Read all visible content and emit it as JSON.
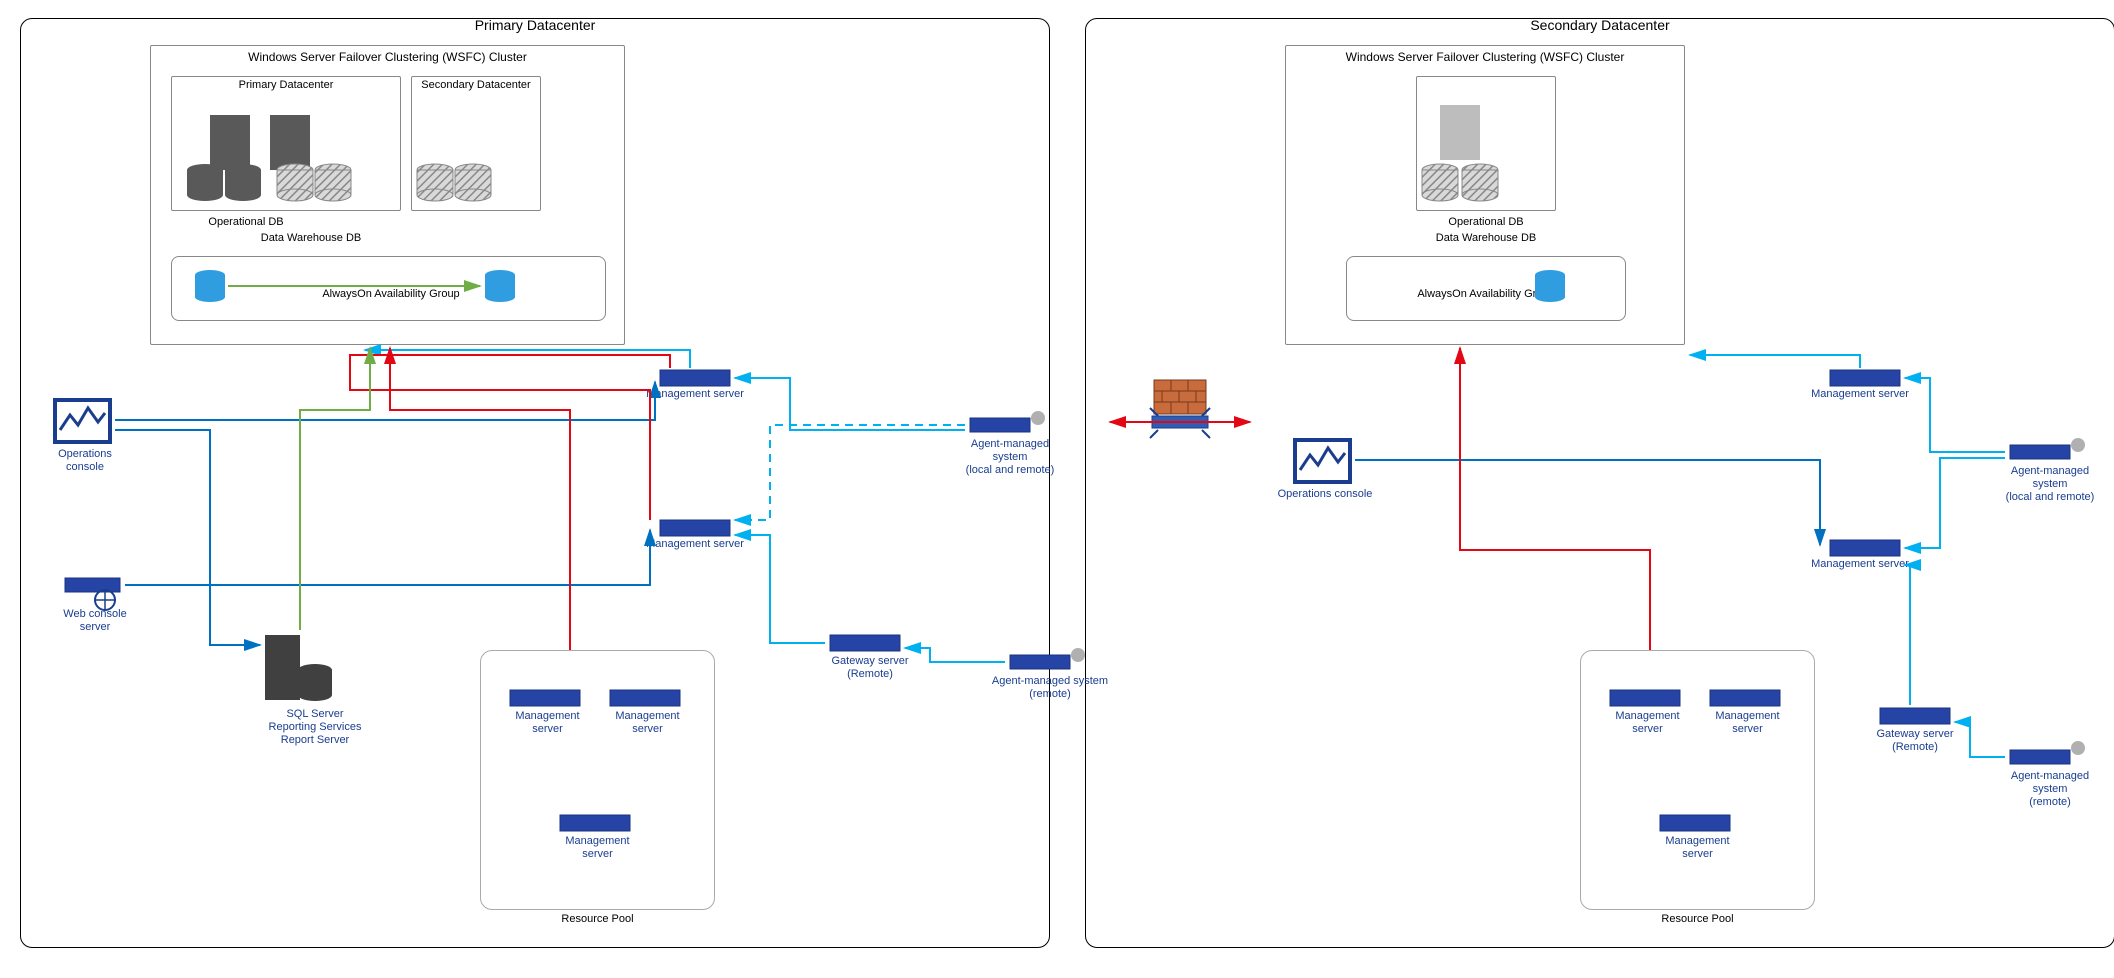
{
  "primary": {
    "title": "Primary Datacenter",
    "wsfc": {
      "title": "Windows Server Failover Clustering (WSFC) Cluster",
      "primaryLabel": "Primary Datacenter",
      "secondaryLabel": "Secondary Datacenter",
      "operationalDb": "Operational DB",
      "dataWarehouseDb": "Data Warehouse DB",
      "alwaysOn": "AlwaysOn Availability Group"
    },
    "operationsConsole": "Operations console",
    "webConsoleServer": "Web console server",
    "sqlReportServer": "SQL Server\nReporting Services\nReport Server",
    "managementServer1": "Management server",
    "managementServer2": "Management server",
    "agentLocalRemote": "Agent-managed system\n(local and remote)",
    "gatewayServer": "Gateway server (Remote)",
    "agentRemote": "Agent-managed system\n(remote)",
    "resourcePool": {
      "title": "Resource Pool",
      "ms1": "Management server",
      "ms2": "Management server",
      "ms3": "Management server"
    }
  },
  "secondary": {
    "title": "Secondary Datacenter",
    "wsfc": {
      "title": "Windows Server Failover Clustering (WSFC) Cluster",
      "operationalDb": "Operational DB",
      "dataWarehouseDb": "Data Warehouse DB",
      "alwaysOn": "AlwaysOn Availability Group"
    },
    "operationsConsole": "Operations console",
    "managementServer1": "Management server",
    "managementServer2": "Management server",
    "agentLocalRemote": "Agent-managed system\n(local and remote)",
    "gatewayServer": "Gateway server (Remote)",
    "agentRemote": "Agent-managed system\n(remote)",
    "resourcePool": {
      "title": "Resource Pool",
      "ms1": "Management server",
      "ms2": "Management server",
      "ms3": "Management server"
    }
  },
  "colors": {
    "blue": "#0070c0",
    "cyan": "#00b0f0",
    "red": "#e30613",
    "green": "#70ad47",
    "navy": "#1a3d8f",
    "rack": "#2644a5"
  }
}
